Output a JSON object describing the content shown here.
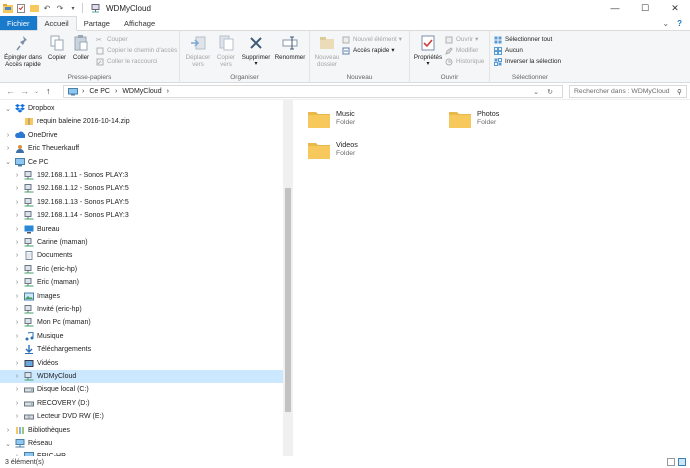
{
  "window": {
    "title": "WDMyCloud",
    "minimize": "—",
    "maximize": "☐",
    "close": "✕"
  },
  "tabs": [
    {
      "label": "Fichier"
    },
    {
      "label": "Accueil"
    },
    {
      "label": "Partage"
    },
    {
      "label": "Affichage"
    }
  ],
  "ribbon": {
    "presse_papiers": {
      "label": "Presse-papiers",
      "pin": "Épingler dans\nAccès rapide",
      "copy": "Copier",
      "paste": "Coller",
      "cut": "Couper",
      "copy_path": "Copier le chemin d'accès",
      "paste_shortcut": "Coller le raccourci"
    },
    "organiser": {
      "label": "Organiser",
      "move": "Déplacer\nvers",
      "copy_to": "Copier\nvers",
      "delete": "Supprimer",
      "rename": "Renommer"
    },
    "nouveau": {
      "label": "Nouveau",
      "new_folder": "Nouveau\ndossier",
      "new_item": "Nouvel élément",
      "easy_access": "Accès rapide"
    },
    "ouvrir": {
      "label": "Ouvrir",
      "properties": "Propriétés",
      "open": "Ouvrir",
      "edit": "Modifier",
      "history": "Historique"
    },
    "selectionner": {
      "label": "Sélectionner",
      "select_all": "Sélectionner tout",
      "select_none": "Aucun",
      "invert": "Inverser la sélection"
    }
  },
  "address": {
    "crumbs": [
      "Ce PC",
      "WDMyCloud"
    ],
    "search_placeholder": "Rechercher dans : WDMyCloud"
  },
  "nav_tree": [
    {
      "label": "Dropbox",
      "icon": "dropbox-icon",
      "chev": "down",
      "indent": 0
    },
    {
      "label": "requin baleine 2016-10-14.zip",
      "icon": "zip-icon",
      "chev": "",
      "indent": 1
    },
    {
      "label": "OneDrive",
      "icon": "onedrive-icon",
      "chev": "right",
      "indent": 0
    },
    {
      "label": "Eric Theuerkauff",
      "icon": "user-icon",
      "chev": "right",
      "indent": 0
    },
    {
      "label": "Ce PC",
      "icon": "pc-icon",
      "chev": "down",
      "indent": 0
    },
    {
      "label": "192.168.1.11 - Sonos PLAY:3",
      "icon": "network-drive-icon",
      "chev": "right",
      "indent": 1
    },
    {
      "label": "192.168.1.12 - Sonos PLAY:5",
      "icon": "network-drive-icon",
      "chev": "right",
      "indent": 1
    },
    {
      "label": "192.168.1.13 - Sonos PLAY:5",
      "icon": "network-drive-icon",
      "chev": "right",
      "indent": 1
    },
    {
      "label": "192.168.1.14 - Sonos PLAY:3",
      "icon": "network-drive-icon",
      "chev": "right",
      "indent": 1
    },
    {
      "label": "Bureau",
      "icon": "desktop-icon",
      "chev": "right",
      "indent": 1
    },
    {
      "label": "Carine (maman)",
      "icon": "network-drive-icon",
      "chev": "right",
      "indent": 1
    },
    {
      "label": "Documents",
      "icon": "documents-icon",
      "chev": "right",
      "indent": 1
    },
    {
      "label": "Eric (eric-hp)",
      "icon": "network-drive-icon",
      "chev": "right",
      "indent": 1
    },
    {
      "label": "Eric (maman)",
      "icon": "network-drive-icon",
      "chev": "right",
      "indent": 1
    },
    {
      "label": "Images",
      "icon": "images-icon",
      "chev": "right",
      "indent": 1
    },
    {
      "label": "Invité (eric-hp)",
      "icon": "network-drive-icon",
      "chev": "right",
      "indent": 1
    },
    {
      "label": "Mon Pc (maman)",
      "icon": "network-drive-icon",
      "chev": "right",
      "indent": 1
    },
    {
      "label": "Musique",
      "icon": "music-icon",
      "chev": "right",
      "indent": 1
    },
    {
      "label": "Téléchargements",
      "icon": "downloads-icon",
      "chev": "right",
      "indent": 1
    },
    {
      "label": "Vidéos",
      "icon": "videos-icon",
      "chev": "right",
      "indent": 1
    },
    {
      "label": "WDMyCloud",
      "icon": "network-drive-icon",
      "chev": "right",
      "indent": 1,
      "selected": true
    },
    {
      "label": "Disque local (C:)",
      "icon": "disk-icon",
      "chev": "right",
      "indent": 1
    },
    {
      "label": "RECOVERY (D:)",
      "icon": "disk-icon",
      "chev": "right",
      "indent": 1
    },
    {
      "label": "Lecteur DVD RW (E:)",
      "icon": "dvd-icon",
      "chev": "right",
      "indent": 1
    },
    {
      "label": "Bibliothèques",
      "icon": "libraries-icon",
      "chev": "right",
      "indent": 0
    },
    {
      "label": "Réseau",
      "icon": "network-icon",
      "chev": "down",
      "indent": 0
    },
    {
      "label": "ERIC-HP",
      "icon": "pc-icon",
      "chev": "right",
      "indent": 1
    }
  ],
  "folders": [
    {
      "name": "Music",
      "type": "Folder"
    },
    {
      "name": "Photos",
      "type": "Folder"
    },
    {
      "name": "Videos",
      "type": "Folder"
    }
  ],
  "status": {
    "count": "3 élément(s)"
  },
  "colors": {
    "accent": "#1979ca",
    "selected": "#cce8ff",
    "folder": "#f7c85c"
  }
}
